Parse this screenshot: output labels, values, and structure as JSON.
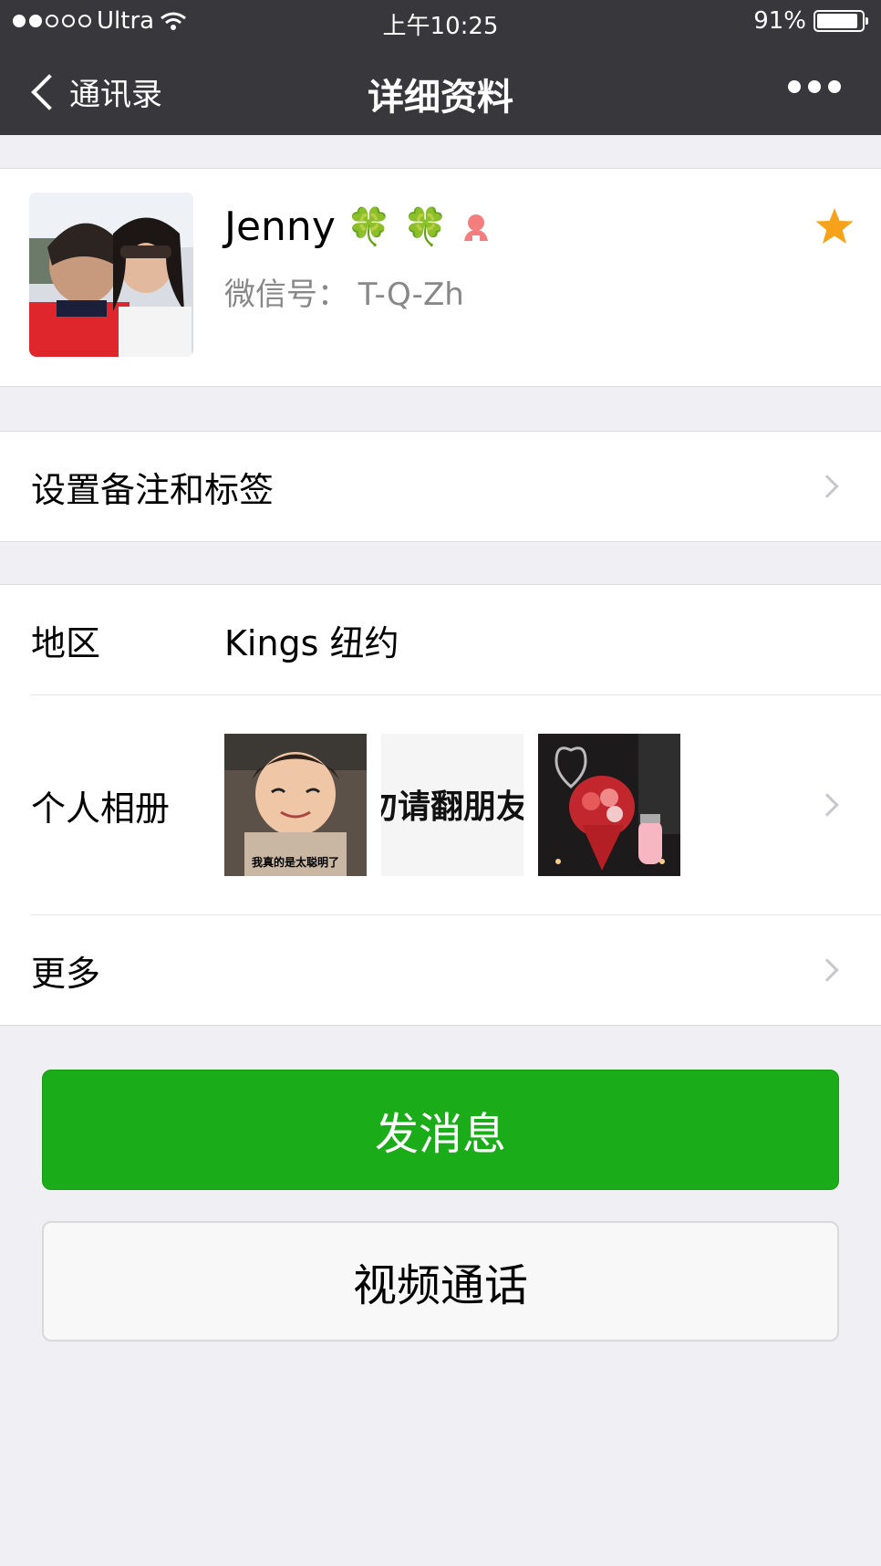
{
  "status_bar": {
    "carrier": "Ultra",
    "time": "上午10:25",
    "battery": "91%",
    "battery_level": 0.91
  },
  "nav": {
    "back_label": "通讯录",
    "title": "详细资料"
  },
  "profile": {
    "name": "Jenny",
    "name_emoji": "🍀",
    "name_emoji_2": "🍀",
    "wechat_id": "微信号： T-Q-Zh",
    "starred": true
  },
  "rows": {
    "remark_label": "设置备注和标签",
    "region_label": "地区",
    "region_value": "Kings 纽约",
    "album_label": "个人相册",
    "album_photo_caption_1": "我真的是太聪明了",
    "album_photo_caption_2": "勿请翻朋友",
    "more_label": "更多"
  },
  "buttons": {
    "message": "发消息",
    "video_call": "视频通话"
  },
  "colors": {
    "nav_bg": "#38373c",
    "primary_green": "#1aad19",
    "star": "#f7a21b",
    "gender_female": "#f37e7d"
  }
}
